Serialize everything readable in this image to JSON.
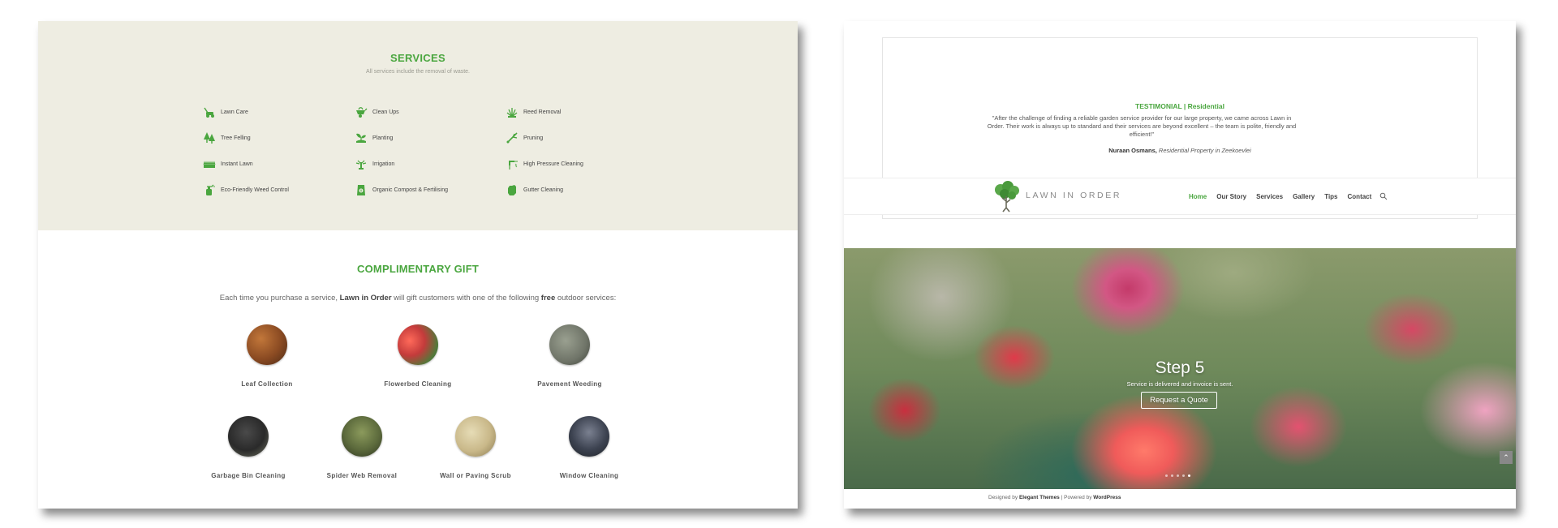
{
  "left": {
    "services": {
      "title": "SERVICES",
      "subtitle": "All services include the removal of waste.",
      "items": [
        {
          "label": "Lawn Care",
          "icon": "lawnmower-icon"
        },
        {
          "label": "Clean Ups",
          "icon": "wheelbarrow-icon"
        },
        {
          "label": "Reed Removal",
          "icon": "reed-icon"
        },
        {
          "label": "Tree Felling",
          "icon": "trees-icon"
        },
        {
          "label": "Planting",
          "icon": "planting-icon"
        },
        {
          "label": "Pruning",
          "icon": "shears-icon"
        },
        {
          "label": "Instant Lawn",
          "icon": "turf-icon"
        },
        {
          "label": "Irrigation",
          "icon": "sprinkler-icon"
        },
        {
          "label": "High Pressure Cleaning",
          "icon": "pressure-washer-icon"
        },
        {
          "label": "Eco-Friendly Weed Control",
          "icon": "spray-bottle-icon"
        },
        {
          "label": "Organic Compost & Fertilising",
          "icon": "compost-bag-icon"
        },
        {
          "label": "Gutter Cleaning",
          "icon": "glove-icon"
        }
      ]
    },
    "gift": {
      "title": "COMPLIMENTARY GIFT",
      "desc_pre": "Each time you purchase a service, ",
      "desc_brand": "Lawn in Order",
      "desc_mid": " will gift customers with one of the following ",
      "desc_free": "free",
      "desc_post": " outdoor services:",
      "items": [
        {
          "label": "Leaf Collection",
          "color": "#8a4a22"
        },
        {
          "label": "Flowerbed Cleaning",
          "color": "#c43b3b"
        },
        {
          "label": "Pavement Weeding",
          "color": "#6f7468"
        },
        {
          "label": "Garbage Bin Cleaning",
          "color": "#2a2a2a"
        },
        {
          "label": "Spider Web Removal",
          "color": "#5c6a3c"
        },
        {
          "label": "Wall or Paving Scrub",
          "color": "#c9b889"
        },
        {
          "label": "Window Cleaning",
          "color": "#3c4250"
        }
      ]
    }
  },
  "right": {
    "testimonial": {
      "title": "TESTIMONIAL | Residential",
      "quote": "\"After the challenge of finding a reliable garden service provider for our large property, we came across Lawn in Order. Their work is always up to standard and their services are beyond excellent – the team is polite, friendly and efficient!\"",
      "author": "Nuraan Osmans,",
      "author_detail": " Residential Property in Zeekoevlei"
    },
    "header": {
      "logo_text": "LAWN IN ORDER",
      "nav": [
        "Home",
        "Our Story",
        "Services",
        "Gallery",
        "Tips",
        "Contact"
      ]
    },
    "hero": {
      "title": "Step 5",
      "subtitle": "Service is delivered and invoice is sent.",
      "button": "Request a Quote",
      "slides": 5,
      "active_slide": 5
    },
    "footer": {
      "pre": "Designed by ",
      "themes": "Elegant Themes",
      "mid": " | Powered by ",
      "wp": "WordPress"
    }
  },
  "colors": {
    "accent": "#4aa63f",
    "services_bg": "#eeede2"
  }
}
